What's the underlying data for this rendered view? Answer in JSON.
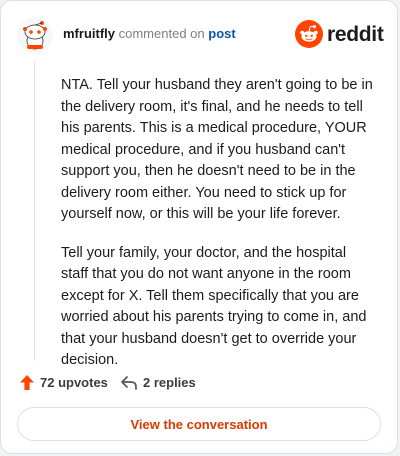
{
  "header": {
    "username": "mfruitfly",
    "verb": "commented on",
    "post_link": "post",
    "brand": "reddit"
  },
  "comment": {
    "paragraphs": [
      "NTA. Tell your husband they aren't going to be in the delivery room, it's final, and he needs to tell his parents. This is a medical procedure, YOUR medical procedure, and if you husband can't support you, then he doesn't need to be in the delivery room either. You need to stick up for yourself now, or this will be your life forever.",
      "Tell your family, your doctor, and the hospital staff that you do not want anyone in the room except for X. Tell them specifically that you are worried about his parents trying to come in, and that your husband doesn't get to override your decision."
    ]
  },
  "actions": {
    "upvotes": "72 upvotes",
    "replies": "2 replies"
  },
  "cta": {
    "label": "View the conversation"
  },
  "colors": {
    "brand": "#ff4500",
    "link": "#0b57a4",
    "cta_text": "#d93a00"
  }
}
